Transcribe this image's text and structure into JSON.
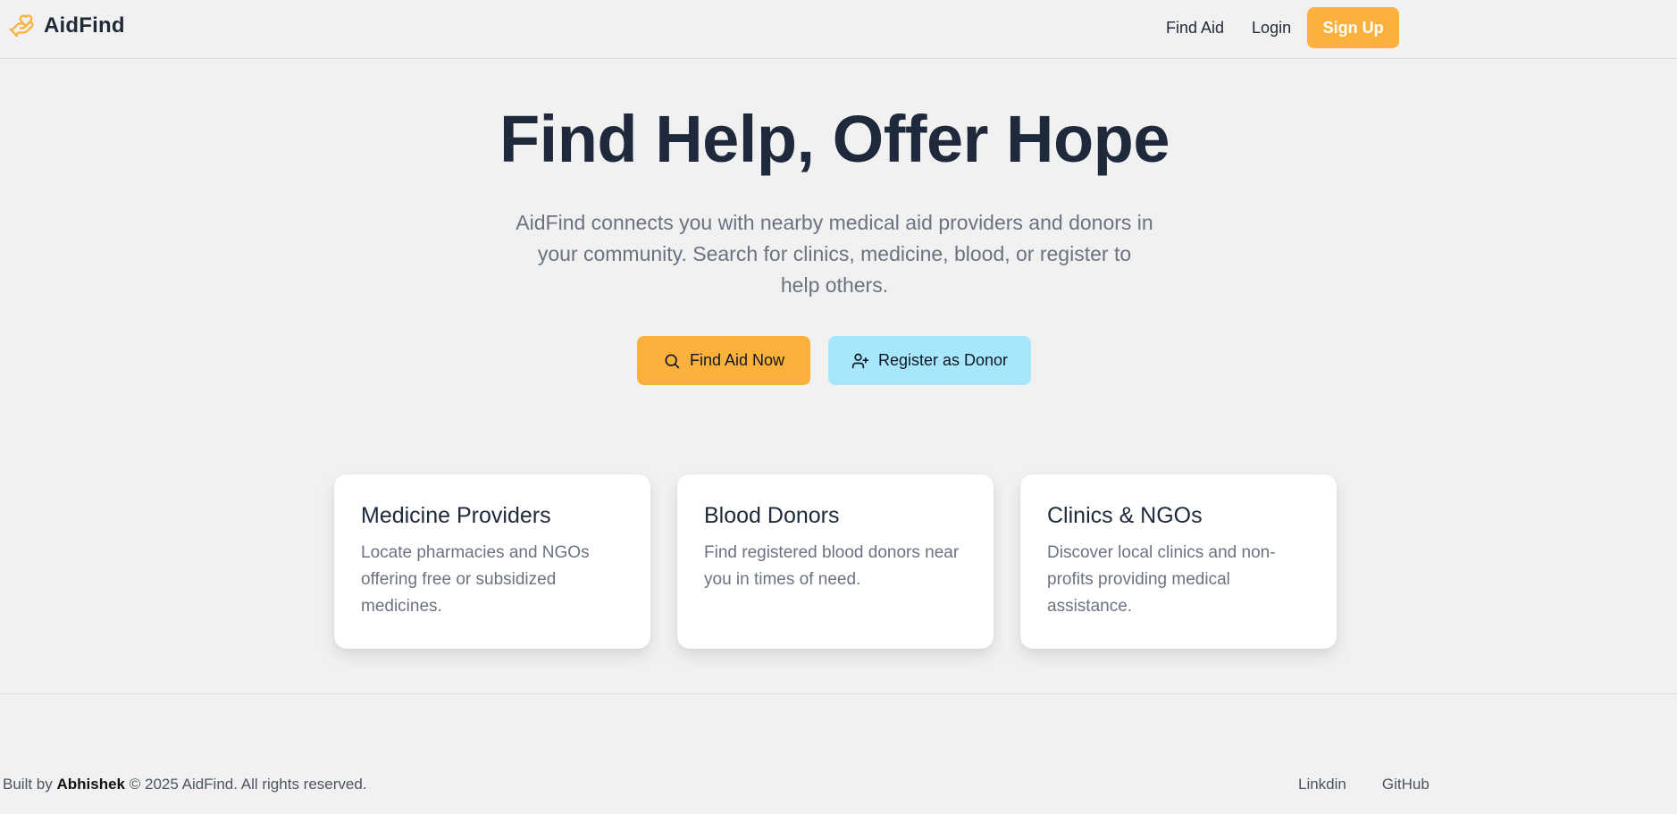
{
  "brand": {
    "name": "AidFind",
    "icon": "hand-heart-icon",
    "color": "#fbb13c"
  },
  "nav": {
    "find_aid": "Find Aid",
    "login": "Login",
    "signup": "Sign Up"
  },
  "hero": {
    "title": "Find Help, Offer Hope",
    "subtitle": "AidFind connects you with nearby medical aid providers and donors in your community. Search for clinics, medicine, blood, or register to help others.",
    "primary_button": {
      "label": "Find Aid Now",
      "icon": "search-icon"
    },
    "secondary_button": {
      "label": "Register as Donor",
      "icon": "user-plus-icon"
    }
  },
  "cards": [
    {
      "title": "Medicine Providers",
      "text": "Locate pharmacies and NGOs offering free or subsidized medicines."
    },
    {
      "title": "Blood Donors",
      "text": "Find registered blood donors near you in times of need."
    },
    {
      "title": "Clinics & NGOs",
      "text": "Discover local clinics and non-profits providing medical assistance."
    }
  ],
  "footer": {
    "built_by_prefix": "Built by",
    "author": "Abhishek",
    "copyright": "© 2025 AidFind. All rights reserved.",
    "links": [
      "Linkdin",
      "GitHub"
    ]
  },
  "colors": {
    "accent": "#fbb13c",
    "secondary": "#a7e6fb",
    "background": "#f1f1f1",
    "heading": "#1e293b",
    "muted": "#6b7280"
  }
}
